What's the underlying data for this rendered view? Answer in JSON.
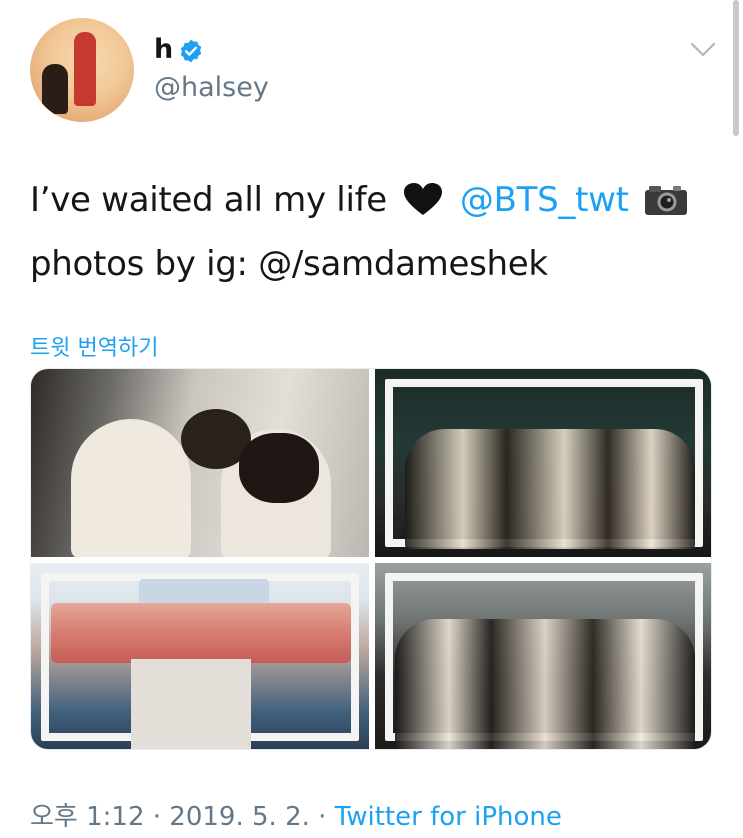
{
  "tweet": {
    "author_name": "h",
    "author_handle": "@halsey",
    "verified_icon": "verified-badge-icon",
    "text_line1_prefix": "I’ve waited all my life",
    "mention": "@BTS_twt",
    "text_line2": "photos by ig: @/samdameshek",
    "translate_label": "트윗 번역하기",
    "footer": {
      "time": "오후 1:12",
      "separator1": " · ",
      "date": "2019. 5. 2.",
      "separator2": " · ",
      "source": "Twitter for iPhone"
    }
  },
  "media": {
    "count": 4
  },
  "colors": {
    "accent": "#1da1f2",
    "text": "#14171a",
    "muted": "#657786"
  }
}
